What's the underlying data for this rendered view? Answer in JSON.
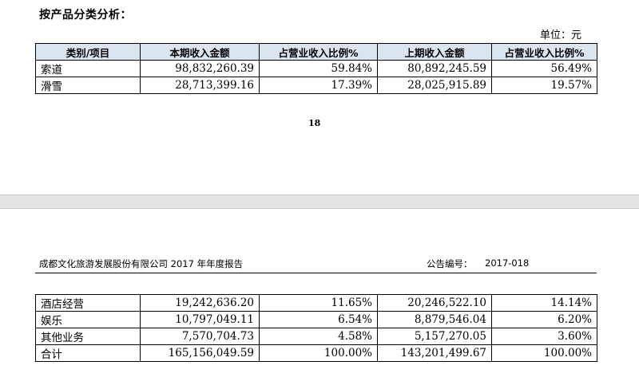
{
  "section_title": "按产品分类分析：",
  "unit_label": "单位：元",
  "page_number": "18",
  "report_title": "成都文化旅游发展股份有限公司 2017 年年度报告",
  "report_code_label": "公告编号：",
  "report_code": "2017-018",
  "table": {
    "headers": [
      "类别/项目",
      "本期收入金额",
      "占营业收入比例%",
      "上期收入金额",
      "占营业收入比例%"
    ],
    "rows_page1": [
      [
        "索道",
        "98,832,260.39",
        "59.84%",
        "80,892,245.59",
        "56.49%"
      ],
      [
        "滑雪",
        "28,713,399.16",
        "17.39%",
        "28,025,915.89",
        "19.57%"
      ]
    ],
    "rows_page2": [
      [
        "酒店经营",
        "19,242,636.20",
        "11.65%",
        "20,246,522.10",
        "14.14%"
      ],
      [
        "娱乐",
        "10,797,049.11",
        "6.54%",
        "8,879,546.04",
        "6.20%"
      ],
      [
        "其他业务",
        "7,570,704.73",
        "4.58%",
        "5,157,270.05",
        "3.60%"
      ],
      [
        "合计",
        "165,156,049.59",
        "100.00%",
        "143,201,499.67",
        "100.00%"
      ]
    ]
  }
}
